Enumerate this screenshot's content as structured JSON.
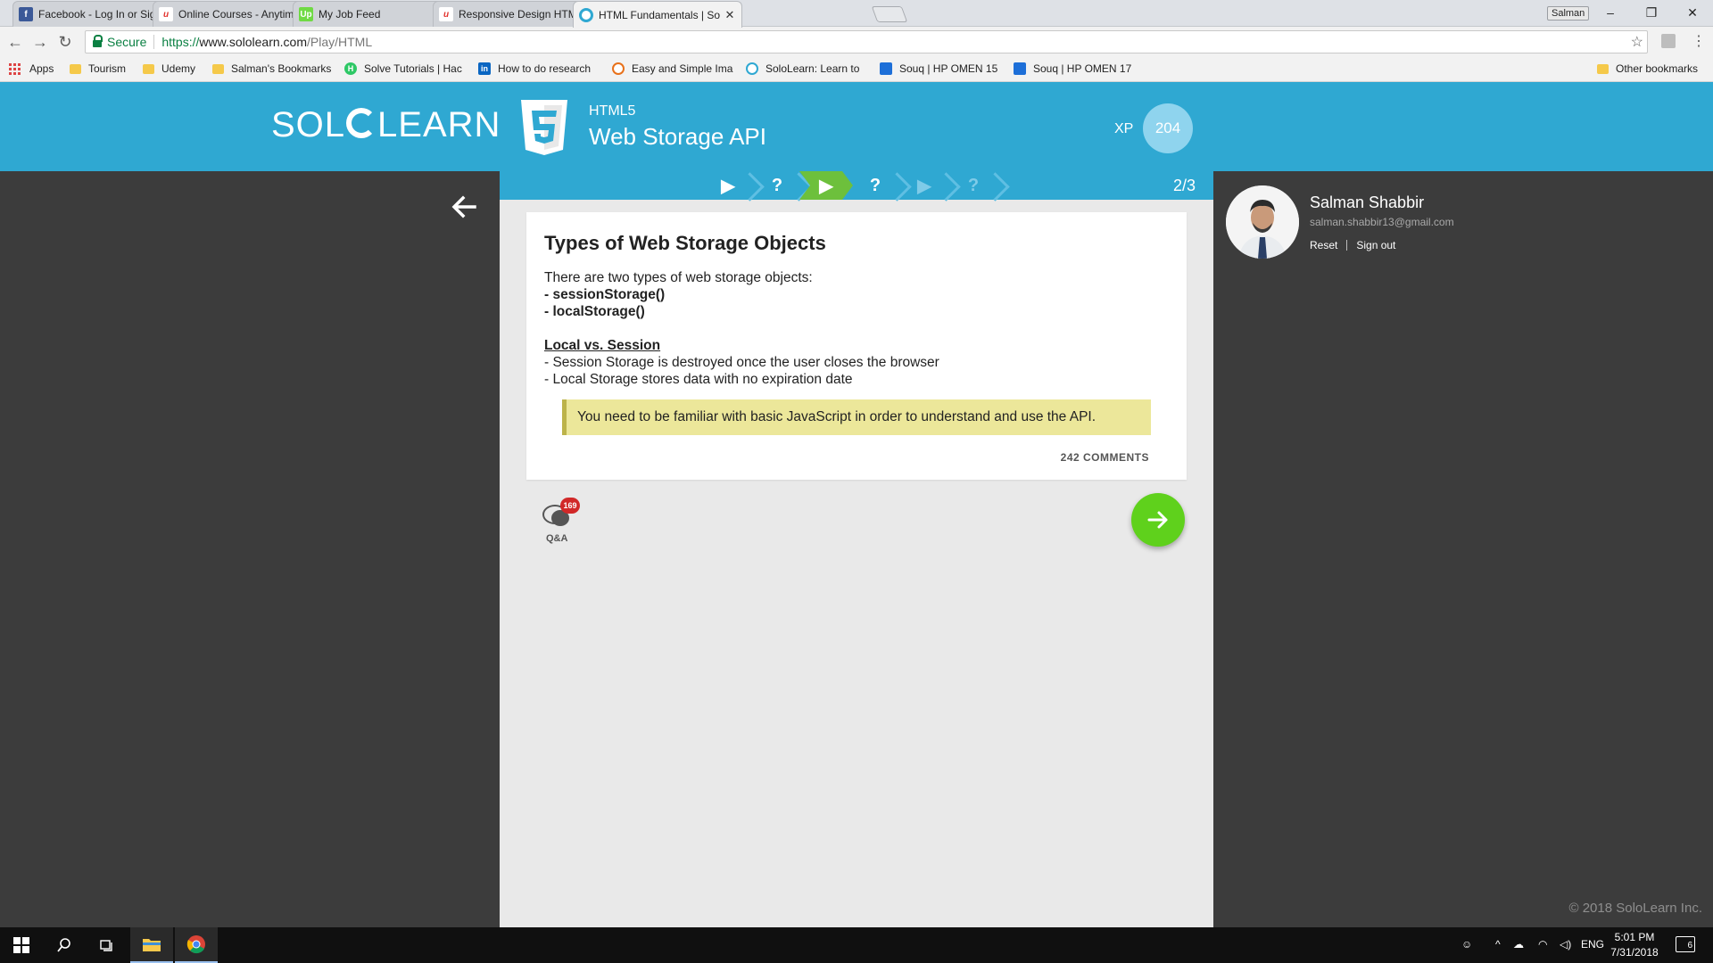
{
  "browser": {
    "tabs": [
      {
        "title": "Facebook - Log In or Sign",
        "favicon": "facebook-icon",
        "color": "#3b5998",
        "active": false
      },
      {
        "title": "Online Courses - Anytime",
        "favicon": "udemy-icon",
        "color": "#e2342f",
        "active": false
      },
      {
        "title": "My Job Feed",
        "favicon": "upwork-icon",
        "color": "#6fda44",
        "active": false
      },
      {
        "title": "Responsive Design HTML",
        "favicon": "udemy-icon",
        "color": "#e2342f",
        "active": false
      },
      {
        "title": "HTML Fundamentals | So",
        "favicon": "sololearn-icon",
        "color": "#2fa8d2",
        "active": true
      }
    ],
    "window_user": "Salman",
    "secure_label": "Secure",
    "url_proto": "https://",
    "url_host": "www.sololearn.com",
    "url_path": "/Play/HTML",
    "bookmarks": [
      {
        "label": "Apps",
        "icon": "apps-grid-icon"
      },
      {
        "label": "Tourism",
        "icon": "folder-icon"
      },
      {
        "label": "Udemy",
        "icon": "folder-icon"
      },
      {
        "label": "Salman's Bookmarks",
        "icon": "folder-icon"
      },
      {
        "label": "Solve Tutorials | Hac",
        "icon": "hackerrank-icon"
      },
      {
        "label": "How to do research",
        "icon": "linkedin-icon"
      },
      {
        "label": "Easy and Simple Ima",
        "icon": "google-icon"
      },
      {
        "label": "SoloLearn: Learn to",
        "icon": "sololearn-icon"
      },
      {
        "label": "Souq | HP OMEN 15",
        "icon": "souq-icon"
      },
      {
        "label": "Souq | HP OMEN 17",
        "icon": "souq-icon"
      }
    ],
    "other_bookmarks": "Other bookmarks"
  },
  "header": {
    "logo_left": "SOL",
    "logo_right": "LEARN",
    "course_subtitle": "HTML5",
    "course_title": "Web Storage API",
    "xp_label": "XP",
    "xp_value": "204"
  },
  "progress": {
    "steps": [
      "▶",
      "?",
      "▶",
      "?",
      "▶",
      "?"
    ],
    "current_index": 2,
    "count": "2/3"
  },
  "lesson": {
    "title": "Types of Web Storage Objects",
    "intro": "There are two types of web storage objects:",
    "item1": "- sessionStorage()",
    "item2": "- localStorage()",
    "section_heading": "Local vs. Session",
    "line1": "- Session Storage is destroyed once the user closes the browser",
    "line2": "- Local Storage stores data with no expiration date",
    "note": "You need to be familiar with basic JavaScript in order to understand and use the API.",
    "comments": "242 COMMENTS"
  },
  "qa": {
    "badge": "169",
    "label": "Q&A"
  },
  "user": {
    "name": "Salman Shabbir",
    "email": "salman.shabbir13@gmail.com",
    "reset": "Reset",
    "signout": "Sign out"
  },
  "footer": {
    "copyright": "© 2018 SoloLearn Inc."
  },
  "taskbar": {
    "lang": "ENG",
    "time": "5:01 PM",
    "date": "7/31/2018",
    "notifications": "6"
  },
  "colors": {
    "brand": "#2fa8d2",
    "progress_current": "#6dc03c",
    "next_button": "#5fd11c",
    "note_bg": "#ece79a",
    "qa_badge": "#d12828"
  }
}
